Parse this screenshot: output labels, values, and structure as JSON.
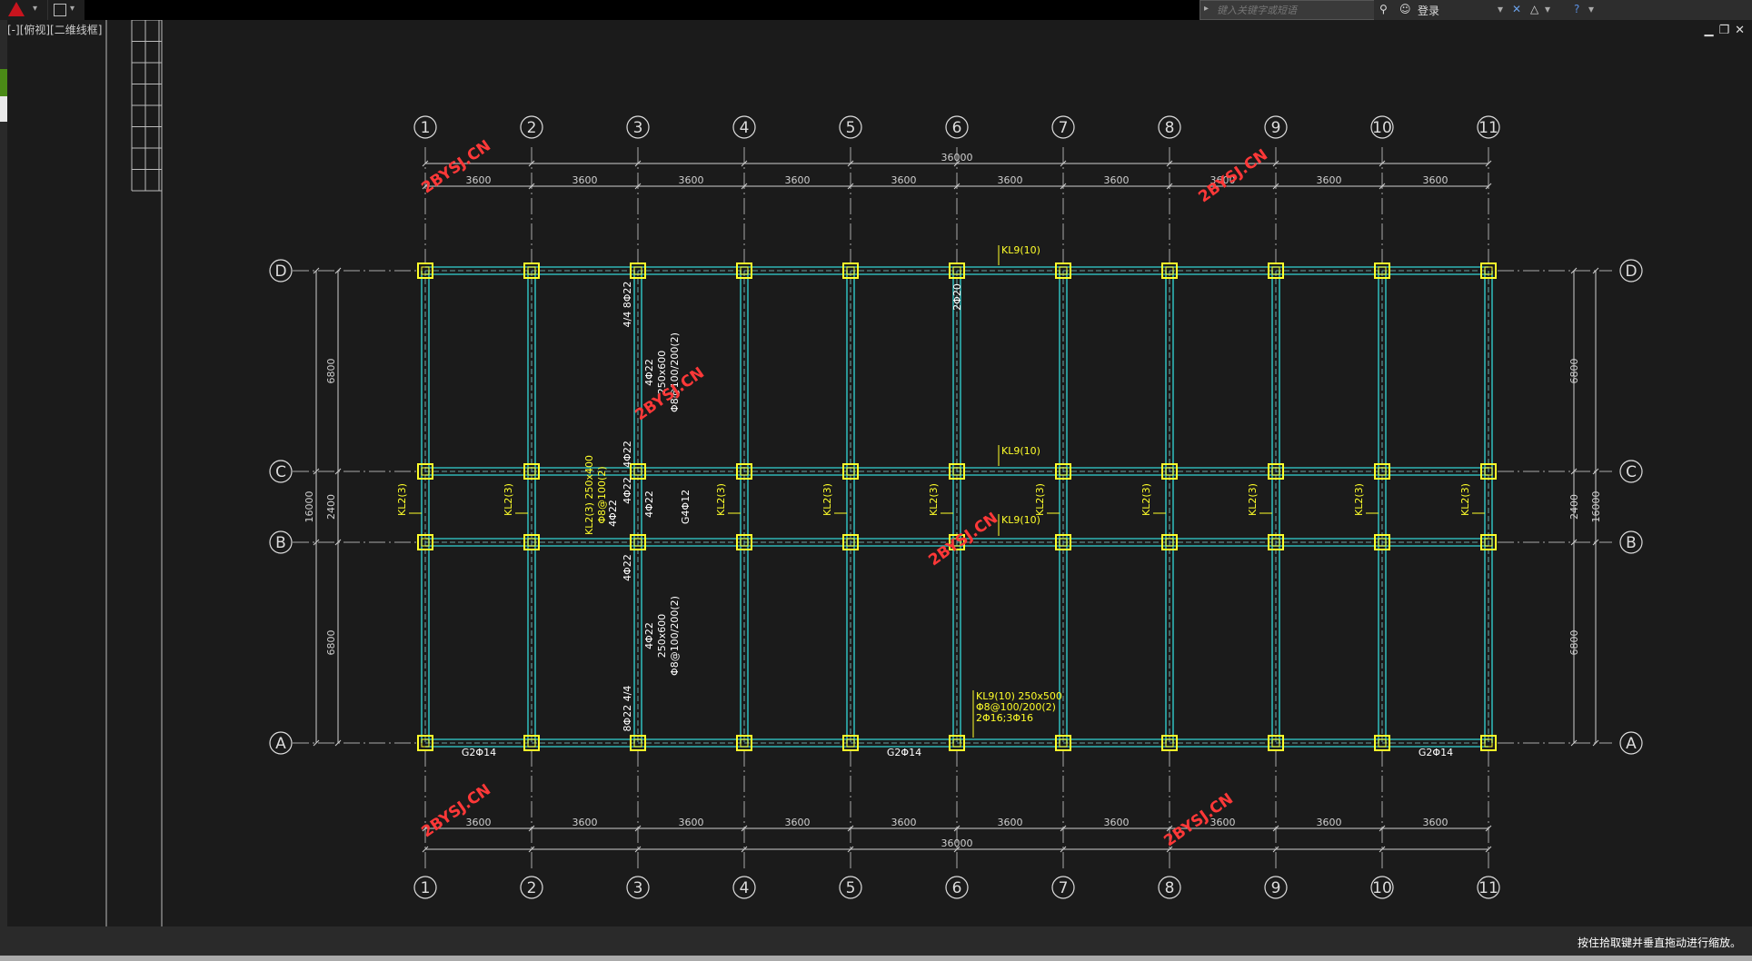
{
  "app": {
    "document_tab": "[-][俯视][二维线框]",
    "search_placeholder": "键入关键字或短语",
    "login_label": "登录",
    "status_hint": "按住拾取键并垂直拖动进行缩放。"
  },
  "drawing": {
    "axis_x_labels": [
      "1",
      "2",
      "3",
      "4",
      "5",
      "6",
      "7",
      "8",
      "9",
      "10",
      "11"
    ],
    "axis_y_labels": [
      "D",
      "C",
      "B",
      "A"
    ],
    "total_width": "36000",
    "bay_dims": [
      "3600",
      "3600",
      "3600",
      "3600",
      "3600",
      "3600",
      "3600",
      "3600",
      "3600",
      "3600"
    ],
    "total_height": "16000",
    "span_dims": [
      "6800",
      "2400",
      "6800"
    ],
    "beam_labels": {
      "kl9_d": "KL9(10)",
      "kl9_c": "KL9(10)",
      "kl9_b": "KL9(10)",
      "kl9_a_1": "KL9(10) 250x500",
      "kl9_a_2": "Φ8@100/200(2)",
      "kl9_a_3": "2Φ16;3Φ16",
      "kl2": "KL2(3)",
      "kl2_3_1": "KL2(3) 250x400",
      "kl2_3_2": "Φ8@100(2)",
      "kl2_3_3": "4Φ22",
      "g2d14": "G2Φ14",
      "g4d12": "G4Φ12",
      "d8d22_top": "4/4 8Φ22",
      "d4d22_a": "4Φ22",
      "d250x600_a": "250x600",
      "stir_a": "Φ8@100/200(2)",
      "d4d22_c": "4Φ22",
      "d4d22_c2": "4Φ22",
      "d4d22_b": "4Φ22",
      "d4d22_b2": "4Φ22",
      "d250x600_b": "250x600",
      "stir_b": "Φ8@100/200(2)",
      "d8d22_bot": "8Φ22 4/4",
      "d2d20": "2Φ20"
    },
    "watermark": "2BYSJ.CN",
    "colors": {
      "beam": "#2fb5b5",
      "column": "#ffff2a",
      "annotation": "#ffff2a",
      "dim": "#cfcfcf",
      "background": "#1b1b1b"
    }
  }
}
